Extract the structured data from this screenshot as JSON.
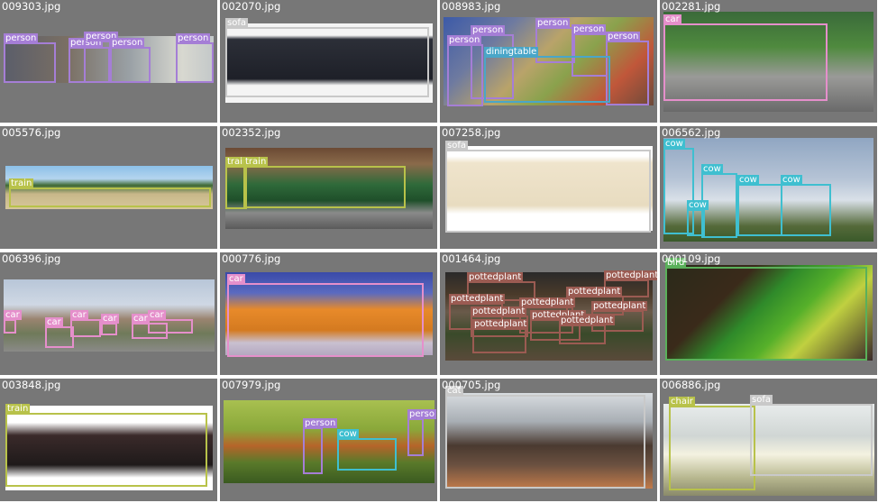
{
  "colors": {
    "person": "#a57ed6",
    "sofa": "#c9c9c9",
    "car": "#e58fcb",
    "diningtable": "#4aa6c8",
    "train": "#b8c24a",
    "cow": "#3fbfd0",
    "pottedplant": "#9b5b52",
    "bird": "#5ab05a",
    "chair": "#b8c24a"
  },
  "cells": [
    {
      "file": "009303.jpg",
      "bg": "linear-gradient(90deg,#5b5e6a 0%,#7a6f63 30%,#9aa1a6 60%,#d8d8d0 85%,#c3c8c9 100%)",
      "photo": [
        5,
        40,
        232,
        52
      ],
      "boxes": [
        {
          "label": "person",
          "cls": "person",
          "r": [
            4,
            47,
            58,
            45
          ],
          "lbl": "person"
        },
        {
          "label": "person",
          "cls": "person",
          "r": [
            76,
            52,
            46,
            40
          ],
          "lbl": "person"
        },
        {
          "label": "person",
          "cls": "person",
          "r": [
            93,
            45,
            30,
            47
          ],
          "lbl": "person"
        },
        {
          "label": "person",
          "cls": "person",
          "r": [
            122,
            52,
            45,
            40
          ],
          "lbl": "person"
        },
        {
          "label": "person",
          "cls": "person",
          "r": [
            195,
            47,
            42,
            45
          ],
          "lbl": "person"
        }
      ]
    },
    {
      "file": "002070.jpg",
      "bg": "linear-gradient(180deg,#f4f4f4 0%,#f4f4f4 15%,#2c2f38 20%,#1e2028 70%,#f4f4f4 78%,#f4f4f4 100%)",
      "photo": [
        6,
        26,
        230,
        88
      ],
      "boxes": [
        {
          "label": "sofa",
          "cls": "sofa",
          "r": [
            6,
            30,
            226,
            78
          ],
          "lbl": "sofa"
        }
      ]
    },
    {
      "file": "008983.jpg",
      "bg": "linear-gradient(135deg,#3c5aa8 0%,#6e7aa0 25%,#b9a36a 45%,#8aa24d 60%,#c0573a 80%,#6b4a3a 100%)",
      "photo": [
        4,
        19,
        233,
        98
      ],
      "boxes": [
        {
          "label": "person",
          "cls": "person",
          "r": [
            8,
            49,
            40,
            69
          ],
          "lbl": "person"
        },
        {
          "label": "person",
          "cls": "person",
          "r": [
            34,
            38,
            48,
            72
          ],
          "lbl": "person"
        },
        {
          "label": "person",
          "cls": "person",
          "r": [
            106,
            30,
            44,
            40
          ],
          "lbl": "person"
        },
        {
          "label": "person",
          "cls": "person",
          "r": [
            146,
            37,
            40,
            48
          ],
          "lbl": "person"
        },
        {
          "label": "person",
          "cls": "person",
          "r": [
            184,
            45,
            48,
            72
          ],
          "lbl": "person"
        },
        {
          "label": "diningtable",
          "cls": "diningtable",
          "r": [
            49,
            62,
            140,
            52
          ],
          "lbl": "diningtable"
        }
      ]
    },
    {
      "file": "002281.jpg",
      "bg": "linear-gradient(180deg,#3a6a3a 0%,#4f8a3e 35%,#9a9a98 65%,#6a6a6a 100%)",
      "photo": [
        4,
        13,
        233,
        111
      ],
      "boxes": [
        {
          "label": "car",
          "cls": "car",
          "r": [
            4,
            26,
            182,
            86
          ],
          "lbl": "car"
        }
      ]
    },
    {
      "file": "005576.jpg",
      "bg": "linear-gradient(180deg,#8cc0e8 0%,#b4d4ee 30%,#3f6a35 45%,#c8b88a 65%,#d6c79a 100%)",
      "photo": [
        6,
        44,
        230,
        48
      ],
      "boxes": [
        {
          "label": "train",
          "cls": "train",
          "r": [
            10,
            68,
            224,
            22
          ],
          "lbl": "train"
        }
      ]
    },
    {
      "file": "002352.jpg",
      "bg": "linear-gradient(180deg,#6b4a34 0%,#8a6a4a 20%,#2f6a3a 45%,#1f4f2a 65%,#8a8a8a 80%,#5a5a5a 100%)",
      "photo": [
        6,
        24,
        230,
        90
      ],
      "boxes": [
        {
          "label": "train",
          "cls": "train",
          "r": [
            6,
            44,
            24,
            48
          ],
          "lbl": "train"
        },
        {
          "label": "train",
          "cls": "train",
          "r": [
            26,
            44,
            180,
            47
          ],
          "lbl": "train"
        }
      ]
    },
    {
      "file": "007258.jpg",
      "bg": "linear-gradient(180deg,#ffffff 0%,#ffffff 12%,#efe4cc 20%,#e8dcc0 70%,#ffffff 80%,#ffffff 100%)",
      "photo": [
        6,
        22,
        230,
        94
      ],
      "boxes": [
        {
          "label": "sofa",
          "cls": "sofa",
          "r": [
            6,
            26,
            228,
            92
          ],
          "lbl": "sofa"
        }
      ]
    },
    {
      "file": "006562.jpg",
      "bg": "linear-gradient(180deg,#90a6c2 0%,#b6c4d6 40%,#d9e0e8 60%,#556a3a 85%,#3a5a2a 100%)",
      "photo": [
        4,
        13,
        233,
        115
      ],
      "boxes": [
        {
          "label": "cow",
          "cls": "cow",
          "r": [
            4,
            24,
            34,
            96
          ],
          "lbl": "cow"
        },
        {
          "label": "cow",
          "cls": "cow",
          "r": [
            30,
            92,
            20,
            30
          ],
          "lbl": "cow"
        },
        {
          "label": "cow",
          "cls": "cow",
          "r": [
            46,
            52,
            40,
            72
          ],
          "lbl": "cow"
        },
        {
          "label": "cow",
          "cls": "cow",
          "r": [
            86,
            64,
            50,
            58
          ],
          "lbl": "cow"
        },
        {
          "label": "cow",
          "cls": "cow",
          "r": [
            134,
            64,
            56,
            58
          ],
          "lbl": "cow"
        }
      ]
    },
    {
      "file": "006396.jpg",
      "bg": "linear-gradient(180deg,#b8c6d8 0%,#cfd8e4 35%,#9a8470 55%,#6f7a5a 75%,#8a8a88 100%)",
      "photo": [
        4,
        30,
        234,
        80
      ],
      "boxes": [
        {
          "label": "car",
          "cls": "car",
          "r": [
            4,
            74,
            14,
            16
          ],
          "lbl": "car"
        },
        {
          "label": "car",
          "cls": "car",
          "r": [
            50,
            82,
            32,
            24
          ],
          "lbl": "car"
        },
        {
          "label": "car",
          "cls": "car",
          "r": [
            78,
            74,
            34,
            20
          ],
          "lbl": "car"
        },
        {
          "label": "car",
          "cls": "car",
          "r": [
            112,
            78,
            18,
            14
          ],
          "lbl": "car"
        },
        {
          "label": "car",
          "cls": "car",
          "r": [
            146,
            78,
            40,
            18
          ],
          "lbl": "car"
        },
        {
          "label": "car",
          "cls": "car",
          "r": [
            164,
            74,
            50,
            16
          ],
          "lbl": "car"
        }
      ]
    },
    {
      "file": "000776.jpg",
      "bg": "linear-gradient(180deg,#3a4aa8 0%,#5a6ac0 25%,#e88a2a 45%,#d47a20 70%,#c9c0d0 85%,#b4a8c0 100%)",
      "photo": [
        6,
        22,
        230,
        92
      ],
      "boxes": [
        {
          "label": "car",
          "cls": "car",
          "r": [
            8,
            34,
            218,
            82
          ],
          "lbl": "car"
        }
      ]
    },
    {
      "file": "001464.jpg",
      "bg": "linear-gradient(180deg,#2a2a2a 0%,#4a3a2a 25%,#6a5a4a 45%,#3a4a2a 70%,#5a4a3a 100%)",
      "photo": [
        6,
        22,
        230,
        98
      ],
      "boxes": [
        {
          "label": "pottedplant",
          "cls": "pottedplant",
          "r": [
            30,
            32,
            76,
            22
          ],
          "lbl": "pottedplant"
        },
        {
          "label": "pottedplant",
          "cls": "pottedplant",
          "r": [
            10,
            56,
            60,
            30
          ],
          "lbl": "pottedplant"
        },
        {
          "label": "pottedplant",
          "cls": "pottedplant",
          "r": [
            34,
            70,
            64,
            24
          ],
          "lbl": "pottedplant"
        },
        {
          "label": "pottedplant",
          "cls": "pottedplant",
          "r": [
            36,
            84,
            60,
            28
          ],
          "lbl": "pottedplant"
        },
        {
          "label": "pottedplant",
          "cls": "pottedplant",
          "r": [
            88,
            60,
            60,
            30
          ],
          "lbl": "pottedplant"
        },
        {
          "label": "pottedplant",
          "cls": "pottedplant",
          "r": [
            100,
            74,
            56,
            24
          ],
          "lbl": "pottedplant"
        },
        {
          "label": "pottedplant",
          "cls": "pottedplant",
          "r": [
            132,
            80,
            52,
            22
          ],
          "lbl": "pottedplant"
        },
        {
          "label": "pottedplant",
          "cls": "pottedplant",
          "r": [
            168,
            64,
            58,
            24
          ],
          "lbl": "pottedplant"
        },
        {
          "label": "pottedplant",
          "cls": "pottedplant",
          "r": [
            182,
            30,
            50,
            20
          ],
          "lbl": "pottedplant"
        },
        {
          "label": "pottedplant",
          "cls": "pottedplant",
          "r": [
            140,
            48,
            64,
            22
          ],
          "lbl": "pottedplant"
        }
      ]
    },
    {
      "file": "000109.jpg",
      "bg": "linear-gradient(135deg,#2a2a1a 0%,#3a2a1a 30%,#2f8a2a 45%,#56b02a 60%,#c0d040 72%,#3a2a2a 100%)",
      "photo": [
        6,
        14,
        230,
        106
      ],
      "boxes": [
        {
          "label": "bird",
          "cls": "bird",
          "r": [
            6,
            16,
            224,
            104
          ],
          "lbl": "bird"
        }
      ]
    },
    {
      "file": "003848.jpg",
      "bg": "linear-gradient(180deg,#ffffff 0%,#ffffff 20%,#3a2a2a 35%,#1f1a1a 70%,#ffffff 85%,#ffffff 100%)",
      "photo": [
        6,
        30,
        230,
        94
      ],
      "boxes": [
        {
          "label": "train",
          "cls": "train",
          "r": [
            6,
            38,
            224,
            82
          ],
          "lbl": "train"
        }
      ]
    },
    {
      "file": "007979.jpg",
      "bg": "linear-gradient(180deg,#a8c050 0%,#8aa83a 35%,#b6642a 55%,#5a7a2a 75%,#3a5a20 100%)",
      "photo": [
        4,
        24,
        234,
        92
      ],
      "boxes": [
        {
          "label": "person",
          "cls": "person",
          "r": [
            92,
            54,
            22,
            52
          ],
          "lbl": "person"
        },
        {
          "label": "cow",
          "cls": "cow",
          "r": [
            130,
            66,
            66,
            36
          ],
          "lbl": "cow"
        },
        {
          "label": "person",
          "cls": "person",
          "r": [
            208,
            44,
            18,
            42
          ],
          "lbl": "perso"
        }
      ]
    },
    {
      "file": "000705.jpg",
      "bg": "linear-gradient(180deg,#d8dce0 0%,#a8aeb4 30%,#4a3a30 55%,#6a5040 75%,#c07a4a 100%)",
      "photo": [
        6,
        16,
        230,
        106
      ],
      "boxes": [
        {
          "label": "cat",
          "cls": "sofa",
          "r": [
            6,
            18,
            222,
            104
          ],
          "lbl": "cat"
        }
      ]
    },
    {
      "file": "006886.jpg",
      "bg": "linear-gradient(180deg,#e8ecec 0%,#d0d6d4 35%,#f4f2e0 55%,#b8b890 80%,#8a8a6a 100%)",
      "photo": [
        4,
        28,
        234,
        102
      ],
      "boxes": [
        {
          "label": "chair",
          "cls": "chair",
          "r": [
            10,
            30,
            96,
            94
          ],
          "lbl": "chair"
        },
        {
          "label": "sofa",
          "cls": "sofa",
          "r": [
            100,
            28,
            136,
            80
          ],
          "lbl": "sofa"
        }
      ]
    }
  ]
}
